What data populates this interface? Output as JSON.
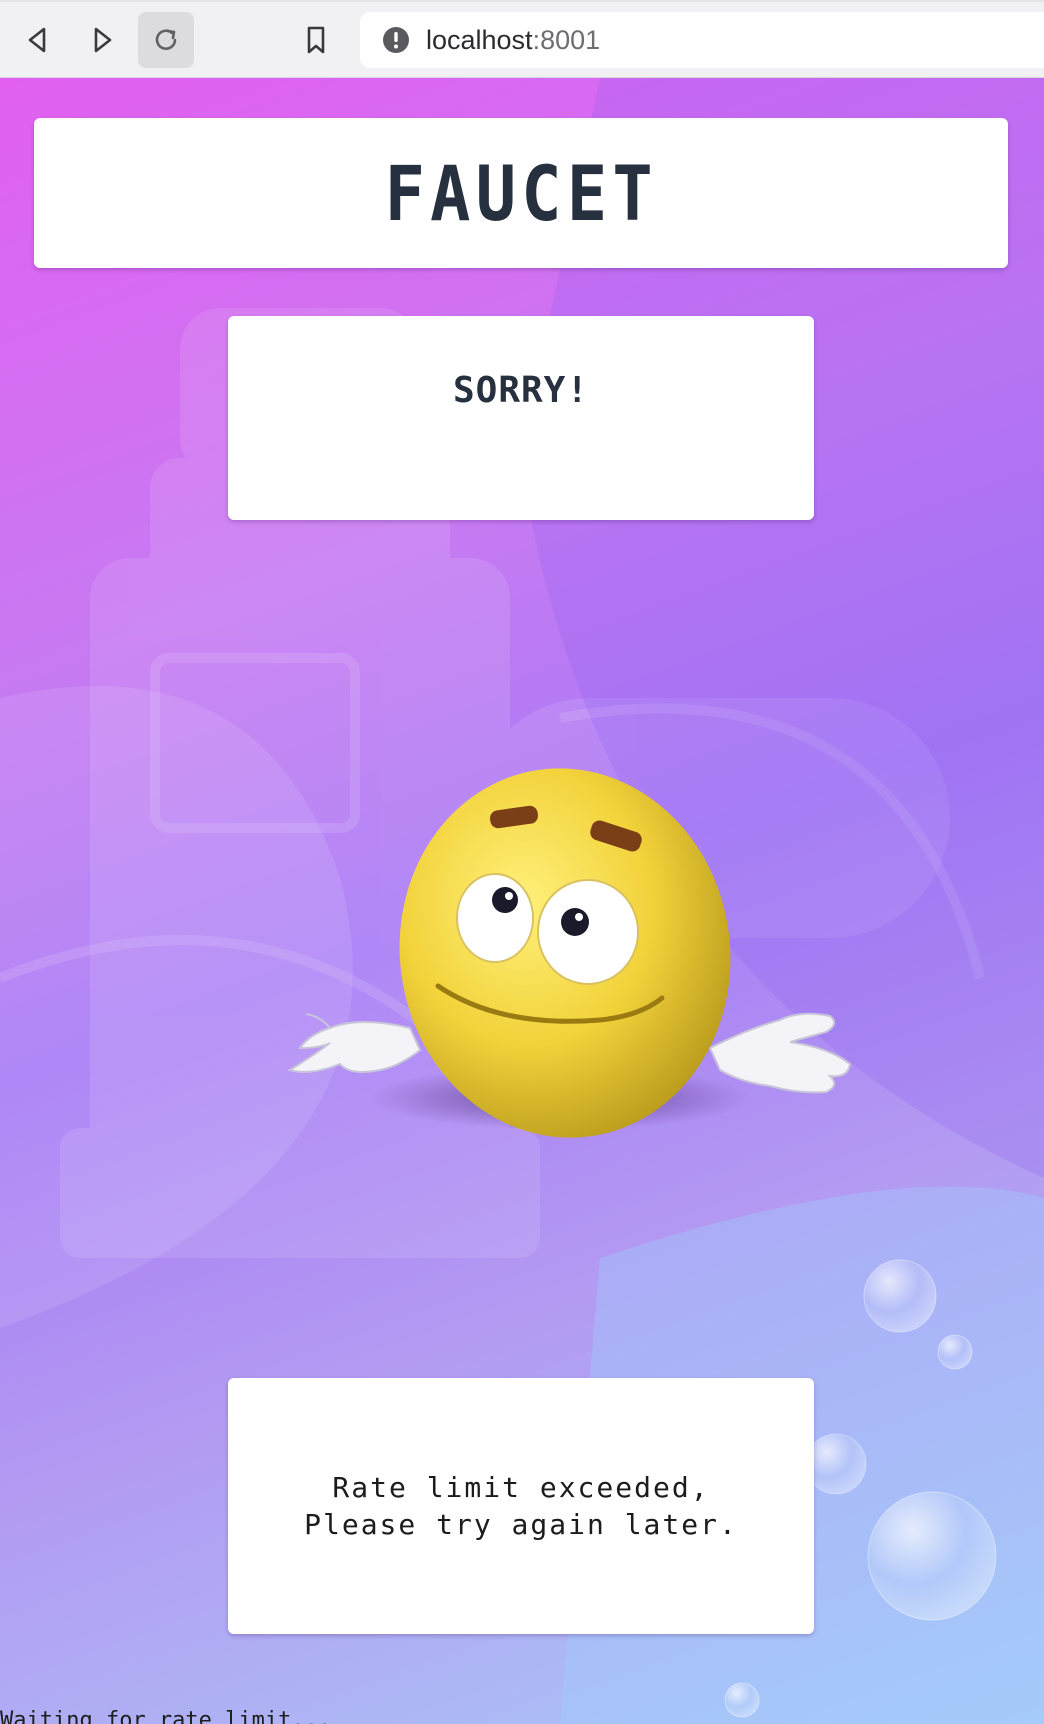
{
  "browser": {
    "url_host": "localhost",
    "url_port": ":8001",
    "icons": [
      "back-arrow-icon",
      "forward-arrow-icon",
      "reload-icon",
      "bookmark-icon",
      "info-icon"
    ]
  },
  "page": {
    "title": "FAUCET",
    "sorry_label": "SORRY!",
    "message_line1": "Rate limit exceeded,",
    "message_line2": "Please try again later.",
    "footer_text": "Waiting for rate limit..."
  },
  "colors": {
    "text_dark": "#27303f",
    "card_bg": "#ffffff",
    "bg_pink": "#e260f0",
    "bg_purple": "#a77af5",
    "bg_blue": "#a9c9f7",
    "emoji_yellow": "#f2d23a"
  }
}
